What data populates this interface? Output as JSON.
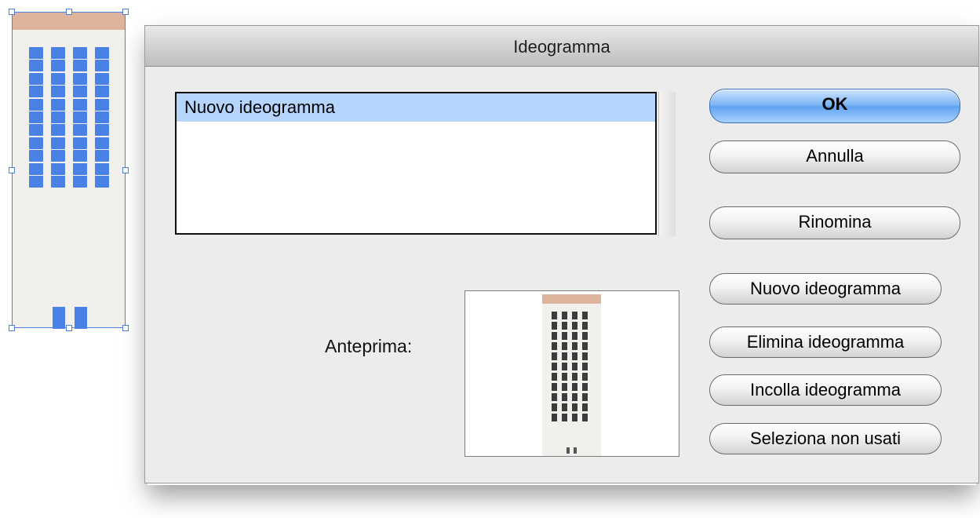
{
  "dialog": {
    "title": "Ideogramma",
    "list_items": [
      "Nuovo ideogramma"
    ],
    "selected_index": 0,
    "preview_label": "Anteprima:",
    "buttons": {
      "ok": "OK",
      "cancel": "Annulla",
      "rename": "Rinomina",
      "new_symbol": "Nuovo ideogramma",
      "delete_symbol": "Elimina ideogramma",
      "paste_symbol": "Incolla ideogramma",
      "select_unused": "Seleziona non usati"
    }
  },
  "artwork": {
    "building_window_rows": 11,
    "building_window_cols": 4,
    "colors": {
      "wall": "#f1f0ec",
      "roof": "#dfb49c",
      "selection": "#4a81e4",
      "preview_window": "#3c3c3c"
    }
  }
}
